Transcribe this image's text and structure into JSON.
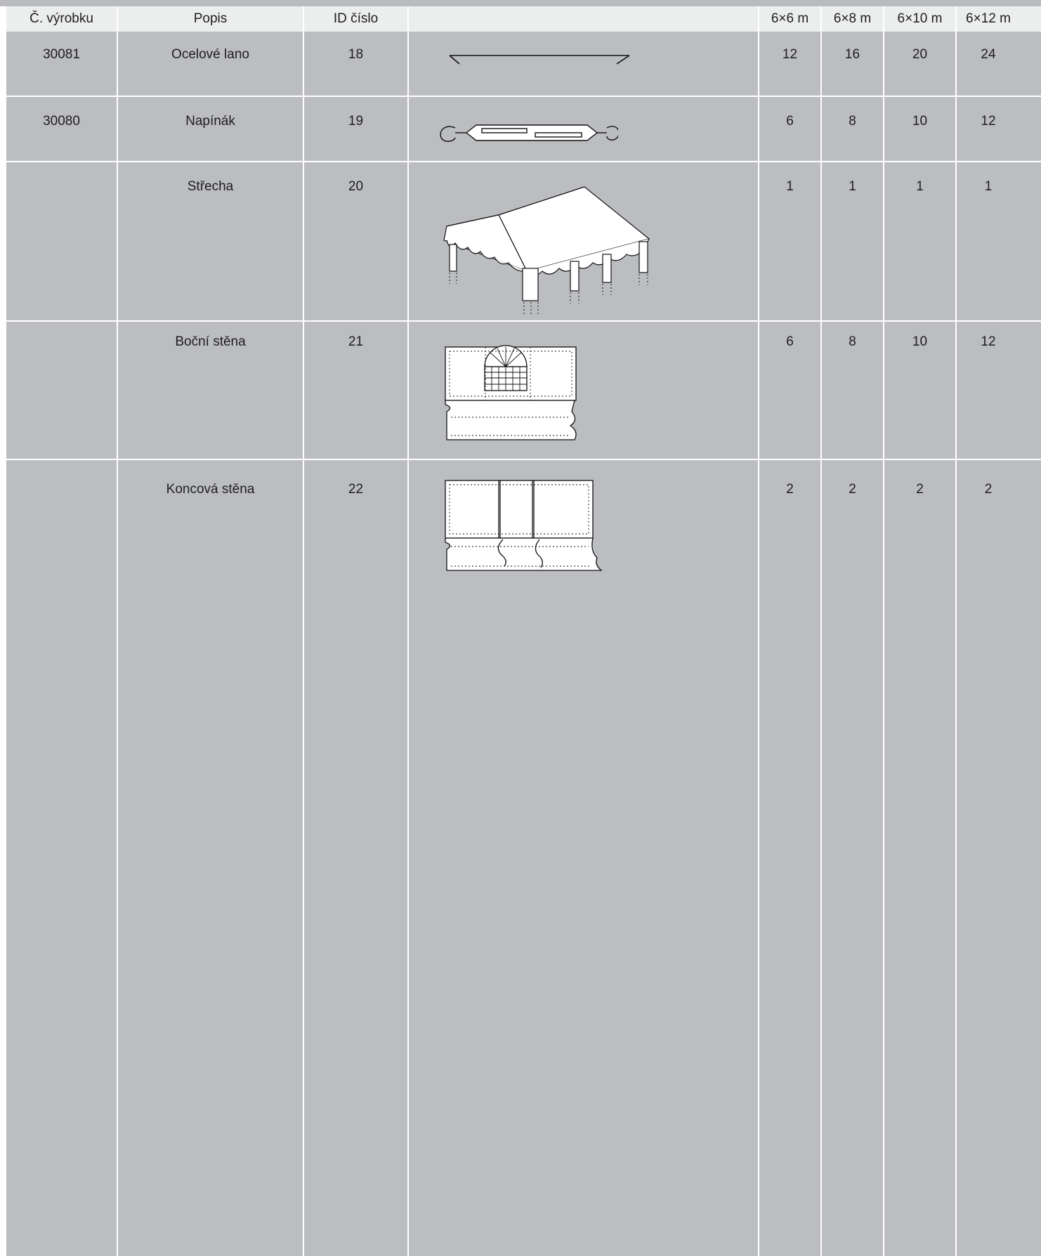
{
  "header": {
    "col_product_no": "Č. výrobku",
    "col_description": "Popis",
    "col_id": "ID číslo",
    "col_image": "",
    "col_6x6": "6×6 m",
    "col_6x8": "6×8 m",
    "col_6x10": "6×10 m",
    "col_6x12": "6×12 m"
  },
  "rows": [
    {
      "product_no": "30081",
      "description": "Ocelové lano",
      "id": "18",
      "icon": "steel-cable-icon",
      "q6x6": "12",
      "q6x8": "16",
      "q6x10": "20",
      "q6x12": "24"
    },
    {
      "product_no": "30080",
      "description": "Napínák",
      "id": "19",
      "icon": "turnbuckle-icon",
      "q6x6": "6",
      "q6x8": "8",
      "q6x10": "10",
      "q6x12": "12"
    },
    {
      "product_no": "",
      "description": "Střecha",
      "id": "20",
      "icon": "tent-roof-icon",
      "q6x6": "1",
      "q6x8": "1",
      "q6x10": "1",
      "q6x12": "1"
    },
    {
      "product_no": "",
      "description": "Boční stěna",
      "id": "21",
      "icon": "side-wall-icon",
      "q6x6": "6",
      "q6x8": "8",
      "q6x10": "10",
      "q6x12": "12"
    },
    {
      "product_no": "",
      "description": "Koncová stěna",
      "id": "22",
      "icon": "end-wall-icon",
      "q6x6": "2",
      "q6x8": "2",
      "q6x10": "2",
      "q6x12": "2"
    }
  ],
  "colors": {
    "header_bg": "#eceded",
    "body_bg": "#bcbdc0",
    "grid": "#ffffff"
  }
}
